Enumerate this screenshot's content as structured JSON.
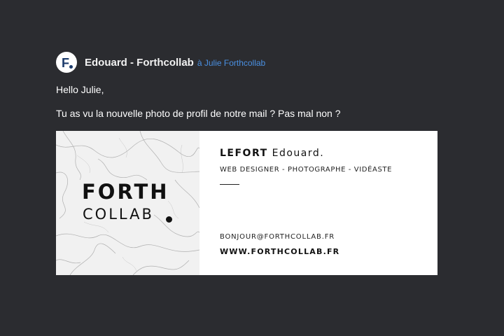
{
  "email": {
    "avatar_letter": "F",
    "sender": "Edouard - Forthcollab",
    "recipient": "à Julie Forthcollab",
    "greeting": "Hello Julie,",
    "message": "Tu as vu la nouvelle photo de profil de notre mail ? Pas mal non ?"
  },
  "signature": {
    "logo_line1": "FORTH",
    "logo_line2": "COLLAB",
    "surname": "LEFORT",
    "firstname": "Edouard.",
    "role": "WEB DESIGNER - PHOTOGRAPHE - VIDÉASTE",
    "email": "BONJOUR@FORTHCOLLAB.FR",
    "website": "WWW.FORTHCOLLAB.FR"
  },
  "colors": {
    "background": "#2b2c30",
    "link": "#4a90e2",
    "avatar_brand": "#1b3a6b"
  }
}
